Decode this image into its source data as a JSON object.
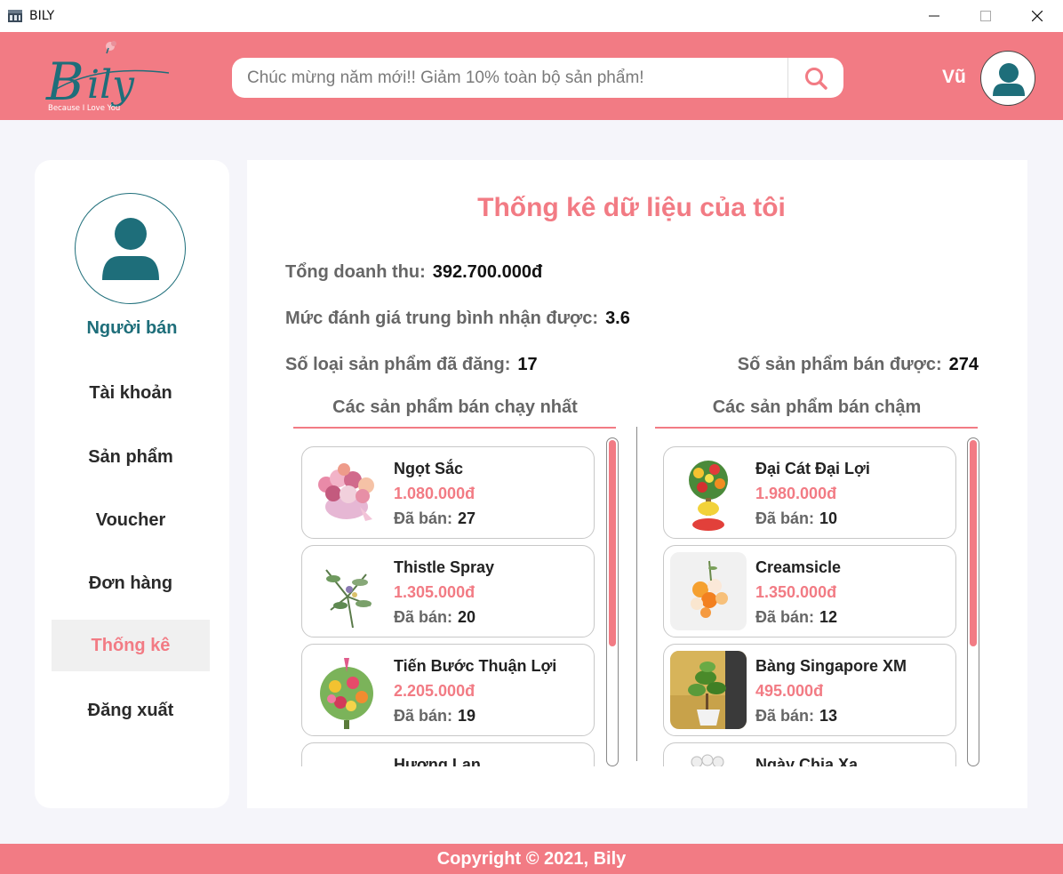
{
  "window": {
    "title": "BILY",
    "minimize_icon": "minimize-icon",
    "maximize_icon": "maximize-icon",
    "close_icon": "close-icon"
  },
  "header": {
    "logo_text": "Bily",
    "logo_tagline": "Because I Love You",
    "search_placeholder": "Chúc mừng năm mới!! Giảm 10% toàn bộ sản phẩm!",
    "search_icon": "search-icon",
    "user_name": "Vũ",
    "avatar_icon": "user-avatar-icon"
  },
  "sidebar": {
    "role": "Người bán",
    "items": [
      {
        "label": "Tài khoản",
        "active": false
      },
      {
        "label": "Sản phẩm",
        "active": false
      },
      {
        "label": "Voucher",
        "active": false
      },
      {
        "label": "Đơn hàng",
        "active": false
      },
      {
        "label": "Thống kê",
        "active": true
      },
      {
        "label": "Đăng xuất",
        "active": false
      }
    ]
  },
  "stats": {
    "title": "Thống kê dữ liệu của tôi",
    "revenue_label": "Tổng doanh thu:",
    "revenue_value": "392.700.000đ",
    "rating_label": "Mức đánh giá trung bình nhận được:",
    "rating_value": "3.6",
    "product_types_label": "Số loại sản phẩm đã đăng:",
    "product_types_value": "17",
    "sold_label": "Số sản phẩm bán được:",
    "sold_value": "274"
  },
  "best_sellers": {
    "heading": "Các sản phẩm bán chạy nhất",
    "sold_prefix": "Đã bán:",
    "items": [
      {
        "name": "Ngọt Sắc",
        "price": "1.080.000đ",
        "sold": "27"
      },
      {
        "name": "Thistle Spray",
        "price": "1.305.000đ",
        "sold": "20"
      },
      {
        "name": "Tiến Bước Thuận Lợi",
        "price": "2.205.000đ",
        "sold": "19"
      },
      {
        "name": "Hương Lan",
        "price": "",
        "sold": ""
      }
    ]
  },
  "slow_sellers": {
    "heading": "Các sản phẩm bán chậm",
    "sold_prefix": "Đã bán:",
    "items": [
      {
        "name": "Đại Cát Đại Lợi",
        "price": "1.980.000đ",
        "sold": "10"
      },
      {
        "name": "Creamsicle",
        "price": "1.350.000đ",
        "sold": "12"
      },
      {
        "name": "Bàng Singapore XM",
        "price": "495.000đ",
        "sold": "13"
      },
      {
        "name": "Ngày Chia Xa",
        "price": "",
        "sold": ""
      }
    ]
  },
  "footer": {
    "text": "Copyright © 2021, Bily"
  },
  "colors": {
    "accent": "#f27b84",
    "teal": "#1e6e7a",
    "background": "#f5f5fa"
  }
}
